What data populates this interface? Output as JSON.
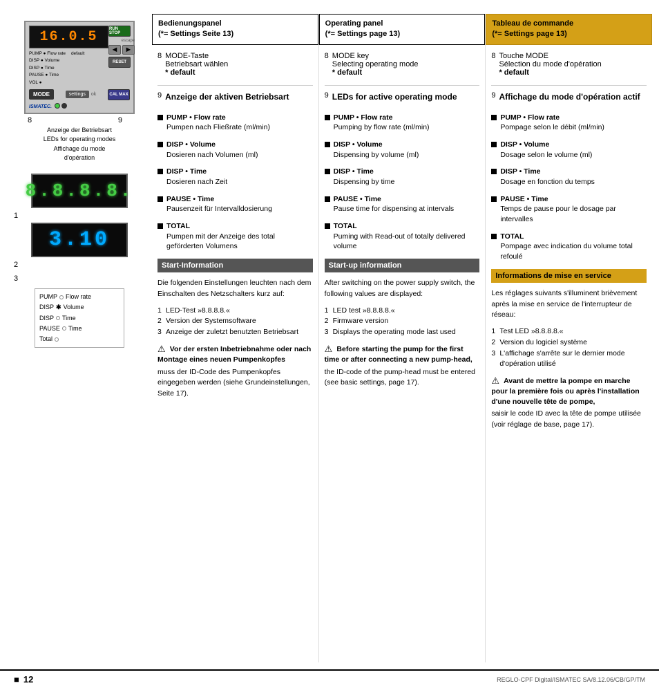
{
  "page": {
    "number": "12",
    "reference": "REGLO-CPF Digital/ISMATEC SA/8.12.06/CB/GP/TM"
  },
  "device": {
    "display_top": "16.0.5",
    "display_1": "8.8.8.8.",
    "display_2": "3.10",
    "label_8": "8",
    "label_9": "9",
    "caption_line1": "Anzeige der Betriebsart",
    "caption_line2": "LEDs for operating modes",
    "caption_line3": "Affichage du mode",
    "caption_line4": "d'opération",
    "led_rows": [
      {
        "label": "PUMP",
        "dot": "circle",
        "text": "Flow rate"
      },
      {
        "label": "DISP",
        "dot": "asterisk",
        "text": "Volume"
      },
      {
        "label": "DISP",
        "dot": "circle",
        "text": "Time"
      },
      {
        "label": "PAUSE",
        "dot": "circle",
        "text": "Time"
      },
      {
        "label": "Total",
        "dot": "circle",
        "text": ""
      }
    ],
    "led_label_number": "3"
  },
  "columns": {
    "de": {
      "header_line1": "Bedienungspanel",
      "header_line2": "(*= Settings Seite 13)",
      "mode_section": {
        "number": "8",
        "title": "MODE-Taste",
        "lines": [
          "Betriebsart wählen",
          "* default"
        ]
      },
      "leds_section": {
        "number": "9",
        "title": "Anzeige der aktiven Betriebsart"
      },
      "items": [
        {
          "title": "PUMP • Flow rate",
          "desc": "Pumpen nach Fließrate (ml/min)"
        },
        {
          "title": "DISP • Volume",
          "desc": "Dosieren nach Volumen (ml)"
        },
        {
          "title": "DISP • Time",
          "desc": "Dosieren nach Zeit"
        },
        {
          "title": "PAUSE • Time",
          "desc": "Pausenzeit für Intervalldosierung"
        },
        {
          "title": "TOTAL",
          "desc": "Pumpen mit der Anzeige des total geförderten Volumens"
        }
      ],
      "startup_header": "Start-Information",
      "startup_text": "Die  folgenden Einstellungen leuchten nach dem Einschalten des Netzschalters kurz auf:",
      "startup_list": [
        "LED-Test »8.8.8.8.«",
        "Version der Systemsoftware",
        "Anzeige der zuletzt benutzten Betriebsart"
      ],
      "warning_bold": "Vor der ersten Inbetriebnahme oder nach Montage eines neuen Pumpenkopfes",
      "warning_text": "muss der ID-Code des Pumpenkopfes eingegeben werden (siehe Grundeinstellungen, Seite 17)."
    },
    "en": {
      "header_line1": "Operating panel",
      "header_line2": "(*= Settings page 13)",
      "mode_section": {
        "number": "8",
        "title": "MODE key",
        "lines": [
          "Selecting operating mode",
          "* default"
        ]
      },
      "leds_section": {
        "number": "9",
        "title": "LEDs for active operating mode"
      },
      "items": [
        {
          "title": "PUMP • Flow rate",
          "desc": "Pumping by flow rate (ml/min)"
        },
        {
          "title": "DISP • Volume",
          "desc": "Dispensing by volume (ml)"
        },
        {
          "title": "DISP • Time",
          "desc": "Dispensing by time"
        },
        {
          "title": "PAUSE • Time",
          "desc": "Pause time for dispensing at intervals"
        },
        {
          "title": "TOTAL",
          "desc": "Puming with Read-out of totally delivered volume"
        }
      ],
      "startup_header": "Start-up information",
      "startup_text": "After switching on the power supply switch, the following values are displayed:",
      "startup_list": [
        "LED test »8.8.8.8.«",
        "Firmware version",
        "Displays the operating mode last used"
      ],
      "warning_bold": "Before starting the pump for the first time or after connecting a new pump-head,",
      "warning_text": "the ID-code of the pump-head must be entered (see basic settings, page 17)."
    },
    "fr": {
      "header_line1": "Tableau de commande",
      "header_line2": "(*= Settings page 13)",
      "mode_section": {
        "number": "8",
        "title": "Touche MODE",
        "lines": [
          "Sélection du mode d'opération",
          "* default"
        ]
      },
      "leds_section": {
        "number": "9",
        "title": "Affichage du mode d'opération actif"
      },
      "items": [
        {
          "title": "PUMP • Flow rate",
          "desc": "Pompage selon le débit (ml/min)"
        },
        {
          "title": "DISP • Volume",
          "desc": "Dosage selon le volume (ml)"
        },
        {
          "title": "DISP • Time",
          "desc": "Dosage en fonction du temps"
        },
        {
          "title": "PAUSE • Time",
          "desc": "Temps de pause pour le dosage par intervalles"
        },
        {
          "title": "TOTAL",
          "desc": "Pompage avec indication du volume total refoulé"
        }
      ],
      "startup_header": "Informations de mise en service",
      "startup_text": "Les réglages suivants s'illuminent brièvement après la mise en service de l'interrupteur de réseau:",
      "startup_list": [
        "Test LED  »8.8.8.8.«",
        "Version du logiciel système",
        "L'affichage s'arrête sur le dernier mode d'opération utilisé"
      ],
      "warning_bold": "Avant de mettre la pompe en marche pour la première fois ou après l'installation d'une nouvelle tête de pompe,",
      "warning_text": "saisir le code ID avec la tête de pompe utilisée  (voir réglage de base, page 17)."
    }
  }
}
